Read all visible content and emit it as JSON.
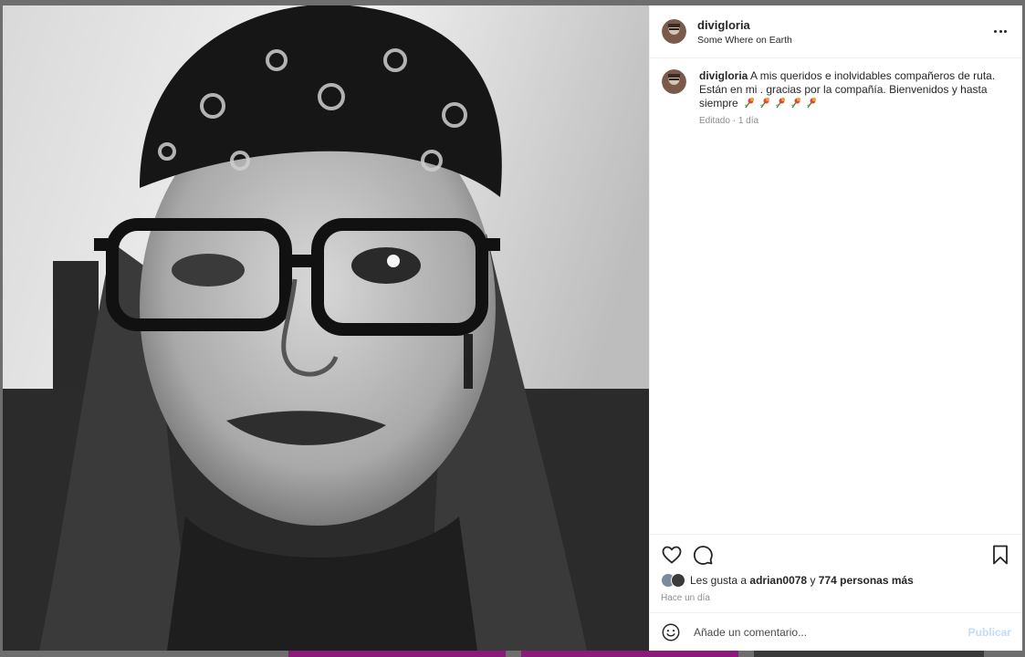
{
  "post": {
    "username": "divigloria",
    "location": "Some Where on Earth",
    "caption_user": "divigloria",
    "caption_text": "A mis queridos e inolvidables compañeros de ruta. Están en mi . gracias por la compañía. Bienvenidos y hasta siempre",
    "caption_emojis": [
      "rose-icon",
      "rose-icon",
      "rose-icon",
      "rose-icon",
      "rose-icon"
    ],
    "edited_label": "Editado",
    "separator": "·",
    "edited_age": "1 día"
  },
  "actions": {
    "like_icon": "heart-icon",
    "comment_icon": "comment-icon",
    "save_icon": "bookmark-icon"
  },
  "likes": {
    "prefix": "Les gusta a",
    "first_user": "adrian0078",
    "connector": "y",
    "others": "774 personas más"
  },
  "timestamp": "Hace un día",
  "comment_box": {
    "placeholder": "Añade un comentario...",
    "publish_label": "Publicar"
  },
  "colors": {
    "publish_disabled": "#c2dcf8",
    "text_primary": "#262626",
    "text_secondary": "#8e8e8e",
    "divider": "#efefef"
  }
}
